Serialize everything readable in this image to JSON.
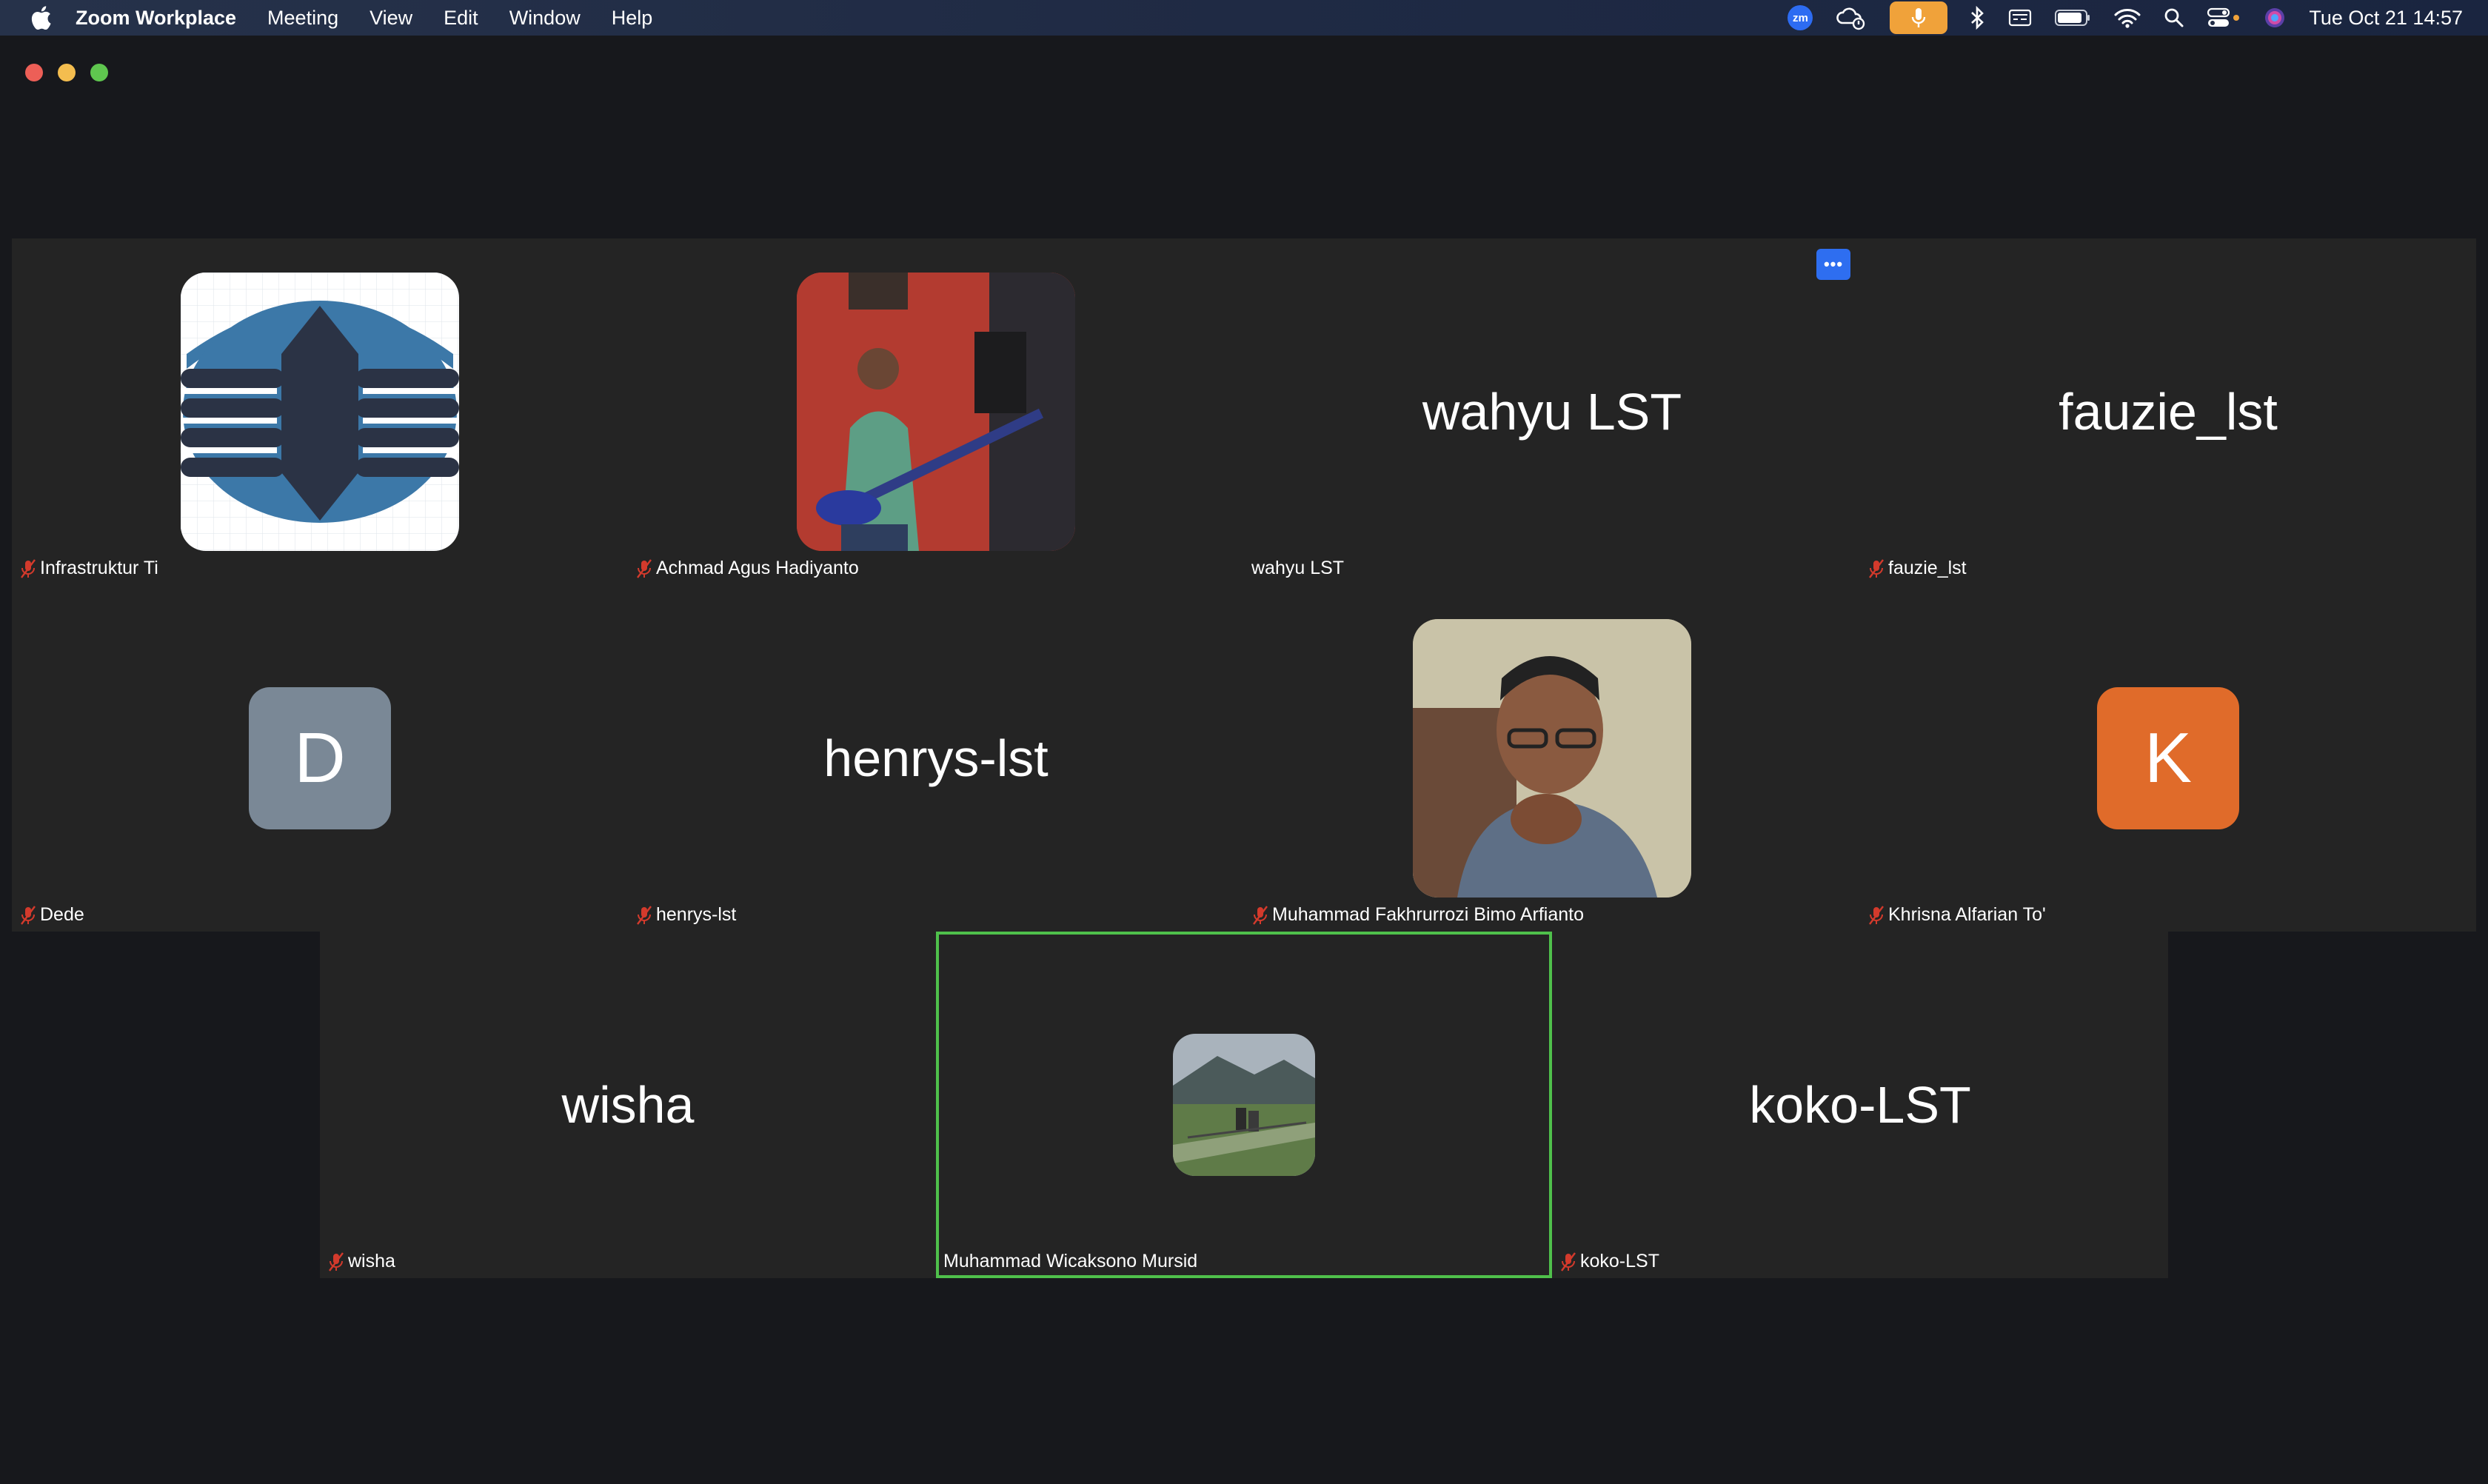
{
  "menubar": {
    "app_name": "Zoom Workplace",
    "items": [
      "Meeting",
      "View",
      "Edit",
      "Window",
      "Help"
    ],
    "zoom_badge": "zm",
    "clock": "Tue Oct 21  14:57"
  },
  "more_button": "•••",
  "participants": [
    {
      "name": "Infrastruktur Ti",
      "display": "logo",
      "muted": true
    },
    {
      "name": "Achmad Agus Hadiyanto",
      "display": "photo",
      "muted": true
    },
    {
      "name": "wahyu LST",
      "display": "name",
      "center_text": "wahyu LST",
      "muted": false
    },
    {
      "name": "fauzie_lst",
      "display": "name",
      "center_text": "fauzie_lst",
      "muted": true
    },
    {
      "name": "Dede",
      "display": "letter",
      "letter": "D",
      "color": "#7a8896",
      "muted": true
    },
    {
      "name": "henrys-lst",
      "display": "name",
      "center_text": "henrys-lst",
      "muted": true
    },
    {
      "name": "Muhammad Fakhrurrozi Bimo Arfianto",
      "display": "photo",
      "muted": true
    },
    {
      "name": "Khrisna Alfarian To'",
      "display": "letter",
      "letter": "K",
      "color": "#e06b2a",
      "muted": true
    },
    {
      "name": "wisha",
      "display": "name",
      "center_text": "wisha",
      "muted": true
    },
    {
      "name": "Muhammad Wicaksono Mursid",
      "display": "photo-small",
      "muted": false,
      "active_speaker": true
    },
    {
      "name": "koko-LST",
      "display": "name",
      "center_text": "koko-LST",
      "muted": true
    }
  ],
  "colors": {
    "menubar": "#1f2a44",
    "tile": "#242424",
    "active_border": "#4fc04b",
    "mute_red": "#d33a2c",
    "more_button": "#2e6ef0"
  }
}
